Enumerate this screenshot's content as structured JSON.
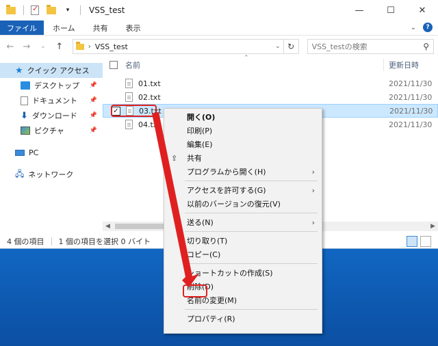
{
  "window": {
    "title": "VSS_test"
  },
  "ribbon": {
    "tabs": [
      "ファイル",
      "ホーム",
      "共有",
      "表示"
    ]
  },
  "address": {
    "path": "VSS_test",
    "search_placeholder": "VSS_testの検索"
  },
  "sidebar": {
    "items": [
      {
        "label": "クイック アクセス",
        "icon": "star-icon"
      },
      {
        "label": "デスクトップ",
        "icon": "desktop-icon"
      },
      {
        "label": "ドキュメント",
        "icon": "document-icon"
      },
      {
        "label": "ダウンロード",
        "icon": "download-icon"
      },
      {
        "label": "ピクチャ",
        "icon": "pictures-icon"
      },
      {
        "label": "PC",
        "icon": "pc-icon"
      },
      {
        "label": "ネットワーク",
        "icon": "network-icon"
      }
    ]
  },
  "columns": {
    "name": "名前",
    "date": "更新日時"
  },
  "files": [
    {
      "name": "01.txt",
      "date": "2021/11/30"
    },
    {
      "name": "02.txt",
      "date": "2021/11/30"
    },
    {
      "name": "03.txt",
      "date": "2021/11/30"
    },
    {
      "name": "04.txt",
      "date": "2021/11/30"
    }
  ],
  "status": {
    "count": "4 個の項目",
    "selection": "1 個の項目を選択  0 バイト"
  },
  "context_menu": {
    "open": "開く(O)",
    "print": "印刷(P)",
    "edit": "編集(E)",
    "share": "共有",
    "open_with": "プログラムから開く(H)",
    "grant_access": "アクセスを許可する(G)",
    "restore": "以前のバージョンの復元(V)",
    "send_to": "送る(N)",
    "cut": "切り取り(T)",
    "copy": "コピー(C)",
    "shortcut": "ショートカットの作成(S)",
    "delete": "削除(D)",
    "rename": "名前の変更(M)",
    "properties": "プロパティ(R)"
  },
  "colors": {
    "accent": "#1a62b8",
    "highlight": "#e02020",
    "selection": "#cce8ff"
  }
}
